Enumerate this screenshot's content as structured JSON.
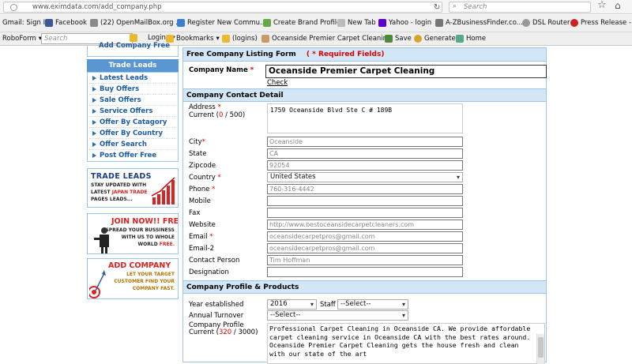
{
  "browser": {
    "url": "www.eximdata.com/add_company.php",
    "search_placeholder": "Search"
  },
  "bookmarks": [
    {
      "label": "Gmail: Sign In",
      "color": "#d44"
    },
    {
      "label": "Facebook",
      "color": "#3b5998"
    },
    {
      "label": "(22) OpenMailBox.org ...",
      "color": "#888"
    },
    {
      "label": "Register New Commu...",
      "color": "#3a7fd0"
    },
    {
      "label": "Create Brand Profile",
      "color": "#6a4"
    },
    {
      "label": "New Tab",
      "color": "#aaa"
    },
    {
      "label": "Yahoo - login",
      "color": "#5f01d1"
    },
    {
      "label": "A-ZBusinessFinder.co...",
      "color": "#777"
    },
    {
      "label": "DSL Router",
      "color": "#999"
    },
    {
      "label": "Press Release - C",
      "color": "#c22"
    }
  ],
  "roboform": {
    "menu": "RoboForm",
    "search_placeholder": "Search",
    "items": [
      "Logins",
      "Bookmarks",
      "(logins)",
      "Oceanside Premier Carpet Cleaning",
      "Save",
      "Generate",
      "Home"
    ]
  },
  "sidebar": {
    "top_link": "Add Company Free",
    "trade_leads_title": "Trade Leads",
    "items": [
      "Latest Leads",
      "Buy Offers",
      "Sale Offers",
      "Service Offers",
      "Offer By Catagory",
      "Offer By Country",
      "Offer Search",
      "Post Offer Free"
    ],
    "banner_trade": {
      "title": "TRADE LEADS",
      "l1": "STAY UPDATED WITH",
      "l2": "LATEST",
      "l2b": "JAPAN TRADE",
      "l3": "PAGES LEADS..."
    },
    "banner_join": {
      "title": "JOIN NOW!! FREE",
      "l1": "SPREAD YOUR BUSSINESS",
      "l2": "WITH US TO WHOLE",
      "l3": "WORLD",
      "l3b": "FREE."
    },
    "banner_add": {
      "title": "ADD COMPANY",
      "l1": "LET YOUR TARGET",
      "l2": "CUSTOMER FIND YOUR",
      "l3": "COMPANY FAST."
    }
  },
  "form": {
    "title": "Free Company Listing Form",
    "required_note": "( * Required Fields)",
    "company_name_label": "Company Name",
    "company_name_value": "Oceanside Premier Carpet Cleaning",
    "check_link": "Check",
    "contact_section": "Company Contact Detail",
    "address_label": "Address",
    "address_current_label": "Current (",
    "address_count": "0",
    "address_max": "/ 500)",
    "address_value": "1759 Oceanside Blvd Ste C # 189B",
    "city_label": "City",
    "city_value": "Oceanside",
    "state_label": "State",
    "state_value": "CA",
    "zip_label": "Zipcode",
    "zip_value": "92054",
    "country_label": "Country",
    "country_value": "United States",
    "phone_label": "Phone",
    "phone_value": "760-316-4442",
    "mobile_label": "Mobile",
    "fax_label": "Fax",
    "website_label": "Website",
    "website_value": "http://www.bestoceansidecarpetcleaners.com",
    "email_label": "Email",
    "email_value": "oceansidecarpetpros@gmail.com",
    "email2_label": "Email-2",
    "email2_value": "oceansidecarpetpros@gmail.com",
    "contact_person_label": "Contact Person",
    "contact_person_value": "Tim Hoffman",
    "designation_label": "Designation",
    "profile_section": "Company Profile & Products",
    "year_label": "Year established",
    "year_value": "2016",
    "staff_label": "Staff",
    "staff_value": "--Select--",
    "turnover_label": "Annual Turnover",
    "turnover_value": "--Select--",
    "profile_label_1": "Company Profile",
    "profile_label_2": "Current (",
    "profile_count": "320",
    "profile_max": "/ 3000)",
    "profile_text": "Professional Carpet Cleaning in Oceanside CA. We provide affordable carpet cleaning service in Oceanside CA with the best rates around. Oceanside Premier Carpet Cleaning gets the house fresh and clean with our state of the art"
  }
}
